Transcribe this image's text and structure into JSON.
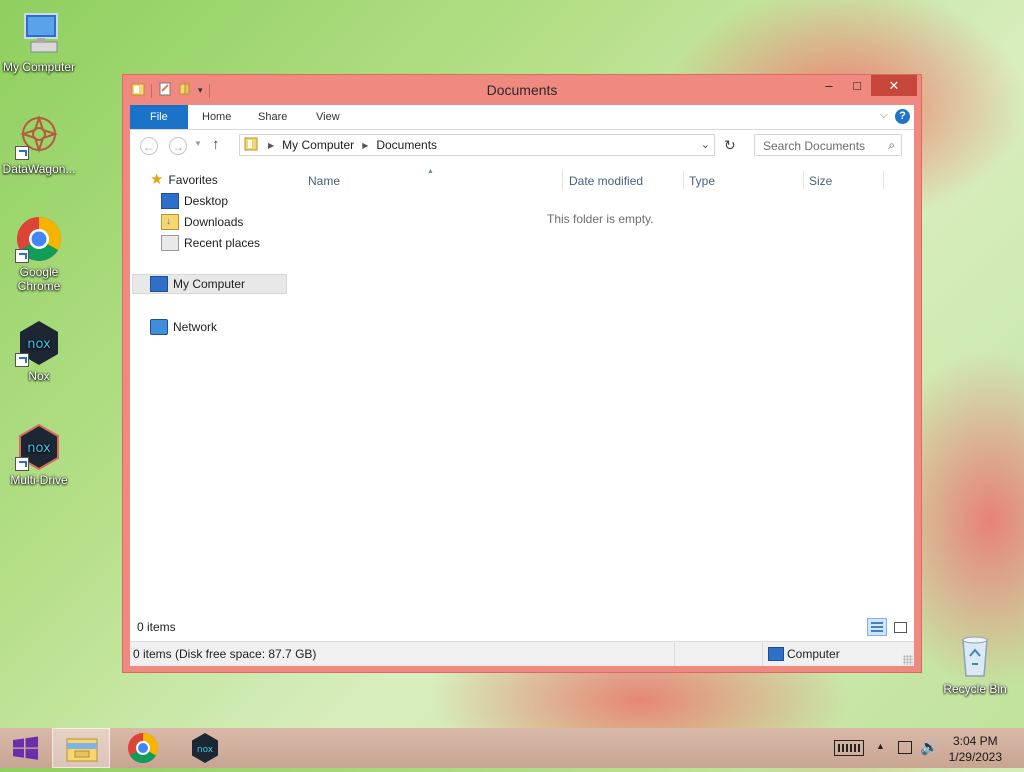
{
  "desktop": {
    "icons": [
      {
        "label": "My Computer"
      },
      {
        "label": "DataWagon..."
      },
      {
        "label": "Google Chrome"
      },
      {
        "label": "Nox"
      },
      {
        "label": "Multi-Drive"
      },
      {
        "label": "Recycle Bin"
      }
    ]
  },
  "window": {
    "title": "Documents",
    "ribbon_tabs": [
      "File",
      "Home",
      "Share",
      "View"
    ],
    "breadcrumb": [
      "My Computer",
      "Documents"
    ],
    "search_placeholder": "Search Documents",
    "nav": {
      "favorites": "Favorites",
      "favorites_items": [
        "Desktop",
        "Downloads",
        "Recent places"
      ],
      "computer": "My Computer",
      "network": "Network"
    },
    "columns": [
      "Name",
      "Date modified",
      "Type",
      "Size"
    ],
    "empty_message": "This folder is empty.",
    "item_count": "0 items",
    "status_left": "0 items (Disk free space: 87.7 GB)",
    "status_right": "Computer"
  },
  "taskbar": {
    "time": "3:04 PM",
    "date": "1/29/2023"
  },
  "colors": {
    "accent": "#1a73c8",
    "window_frame": "#f08a80",
    "close_button": "#c7473b"
  }
}
